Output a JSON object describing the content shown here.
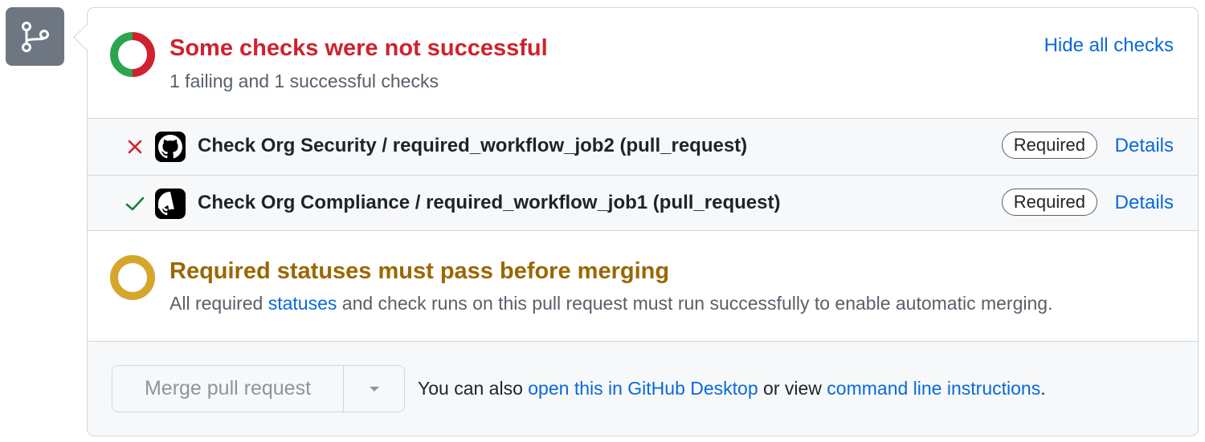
{
  "header": {
    "title": "Some checks were not successful",
    "subtitle": "1 failing and 1 successful checks",
    "hide_link": "Hide all checks"
  },
  "checks": [
    {
      "status": "failure",
      "status_icon": "x-icon",
      "avatar_icon": "github-logo-icon",
      "name": "Check Org Security / required_workflow_job2 (pull_request)",
      "badge": "Required",
      "details": "Details"
    },
    {
      "status": "success",
      "status_icon": "check-icon",
      "avatar_icon": "github-logo-icon",
      "name": "Check Org Compliance / required_workflow_job1 (pull_request)",
      "badge": "Required",
      "details": "Details"
    }
  ],
  "required_statuses": {
    "title": "Required statuses must pass before merging",
    "desc_before": "All required ",
    "desc_link": "statuses",
    "desc_after": " and check runs on this pull request must run successfully to enable automatic merging."
  },
  "merge": {
    "button_label": "Merge pull request",
    "text_before": "You can also ",
    "link1": "open this in GitHub Desktop",
    "text_mid": " or view ",
    "link2": "command line instructions",
    "text_end": "."
  },
  "colors": {
    "failure": "#cf222e",
    "success": "#2da44e",
    "pending": "#d4a72c",
    "link": "#0969da"
  }
}
